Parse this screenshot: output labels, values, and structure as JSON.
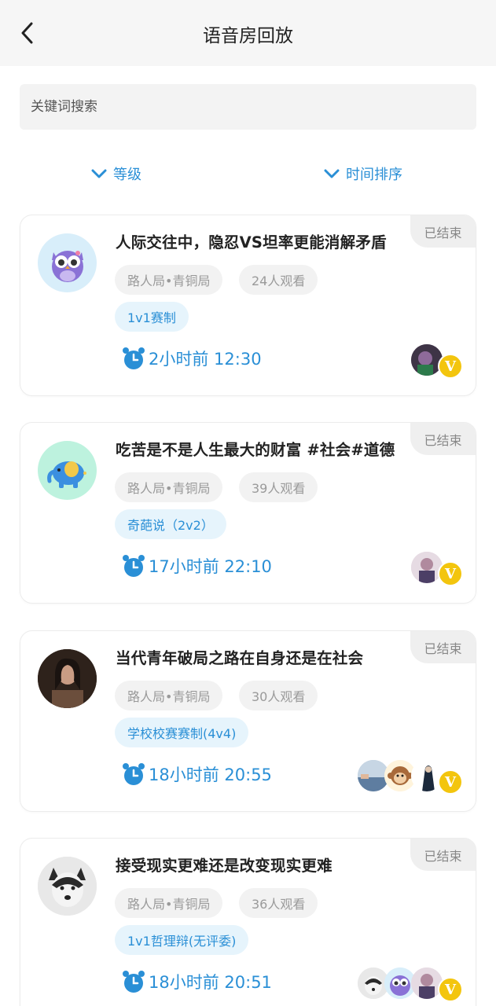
{
  "header": {
    "title": "语音房回放"
  },
  "search": {
    "placeholder": "关键词搜索"
  },
  "filters": {
    "level_label": "等级",
    "time_sort_label": "时间排序"
  },
  "rooms": [
    {
      "title": "人际交往中，隐忍VS坦率更能消解矛盾",
      "status": "已结束",
      "rank": "路人局•青铜局",
      "views": "24人观看",
      "format": "1v1赛制",
      "time": "2小时前 12:30",
      "avatar_icon": "owl-icon",
      "badge": "V"
    },
    {
      "title": "吃苦是不是人生最大的财富 #社会#道德",
      "status": "已结束",
      "rank": "路人局•青铜局",
      "views": "39人观看",
      "format": "奇葩说（2v2）",
      "time": "17小时前 22:10",
      "avatar_icon": "elephant-icon",
      "badge": "V"
    },
    {
      "title": "当代青年破局之路在自身还是在社会",
      "status": "已结束",
      "rank": "路人局•青铜局",
      "views": "30人观看",
      "format": "学校校赛赛制(4v4)",
      "time": "18小时前 20:55",
      "avatar_icon": "portrait-photo",
      "badge": "V"
    },
    {
      "title": "接受现实更难还是改变现实更难",
      "status": "已结束",
      "rank": "路人局•青铜局",
      "views": "36人观看",
      "format": "1v1哲理辩(无评委)",
      "time": "18小时前 20:51",
      "avatar_icon": "husky-dog-photo",
      "badge": "V"
    }
  ],
  "colors": {
    "accent": "#2a8fd6",
    "badge": "#f3c50e",
    "chip_bg": "#f2f2f2",
    "format_bg": "#e6f4fc"
  }
}
